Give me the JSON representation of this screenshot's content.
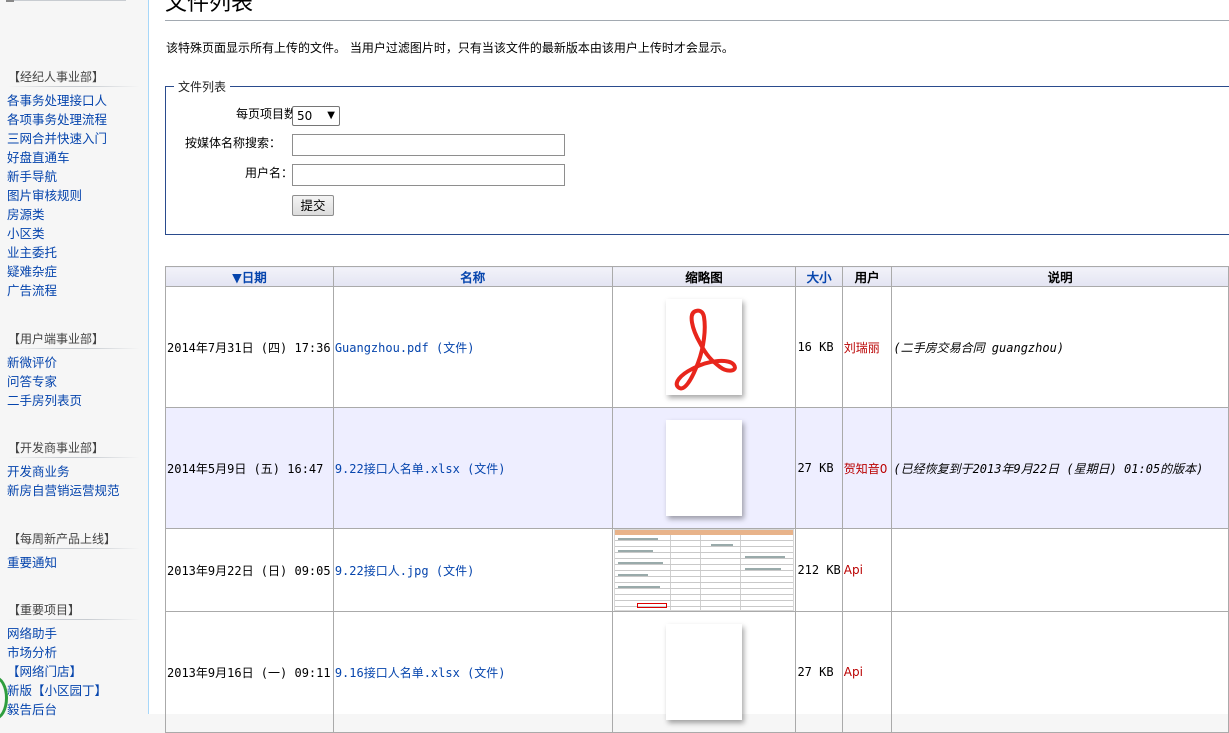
{
  "sidebar": {
    "portals": [
      {
        "title": "【经纪人事业部】",
        "items": [
          "各事务处理接口人",
          "各项事务处理流程",
          "三网合并快速入门",
          "好盘直通车",
          "新手导航",
          "图片审核规则",
          "房源类",
          "小区类",
          "业主委托",
          "疑难杂症",
          "广告流程"
        ]
      },
      {
        "title": "【用户端事业部】",
        "items": [
          "新微评价",
          "问答专家",
          "二手房列表页"
        ]
      },
      {
        "title": "【开发商事业部】",
        "items": [
          "开发商业务",
          "新房自营销运营规范"
        ]
      },
      {
        "title": "【每周新产品上线】",
        "items": [
          "重要通知"
        ]
      },
      {
        "title": "【重要项目】",
        "items": [
          "网络助手",
          "市场分析",
          "【网络门店】",
          "新版【小区园丁】",
          "毅告后台"
        ]
      }
    ]
  },
  "page": {
    "title": "文件列表",
    "intro": "该特殊页面显示所有上传的文件。 当用户过滤图片时，只有当该文件的最新版本由该用户上传时才会显示。"
  },
  "form": {
    "legend": "文件列表",
    "limit_label": "每页项目数：",
    "limit_value": "50",
    "search_label": "按媒体名称搜索：",
    "search_value": "",
    "user_label": "用户名：",
    "user_value": "",
    "submit_label": "提交"
  },
  "table": {
    "headers": {
      "date": "日期",
      "name": "名称",
      "thumb": "缩略图",
      "size": "大小",
      "user": "用户",
      "desc": "说明"
    },
    "rows": [
      {
        "date": "2014年7月31日 (四) 17:36",
        "name": "Guangzhou.pdf",
        "file_link": "(文件)",
        "thumb": "pdf-icon",
        "size": "16 KB",
        "user": "刘瑞丽",
        "desc": "(二手房交易合同 guangzhou)"
      },
      {
        "date": "2014年5月9日 (五) 16:47",
        "name": "9.22接口人名单.xlsx",
        "file_link": "(文件)",
        "thumb": "blank-doc",
        "size": "27 KB",
        "user": "贺知音0",
        "desc": "(已经恢复到于2013年9月22日 (星期日) 01:05的版本)"
      },
      {
        "date": "2013年9月22日 (日) 09:05",
        "name": "9.22接口人.jpg",
        "file_link": "(文件)",
        "thumb": "spreadsheet-image",
        "size": "212 KB",
        "user": "Api",
        "desc": ""
      },
      {
        "date": "2013年9月16日 (一) 09:11",
        "name": "9.16接口人名单.xlsx",
        "file_link": "(文件)",
        "thumb": "blank-doc",
        "size": "27 KB",
        "user": "Api",
        "desc": ""
      }
    ]
  },
  "colors": {
    "link": "#0645ad",
    "user_red": "#ba0000",
    "pdf_red": "#e8261c",
    "row_alt": "#eeeeff"
  }
}
